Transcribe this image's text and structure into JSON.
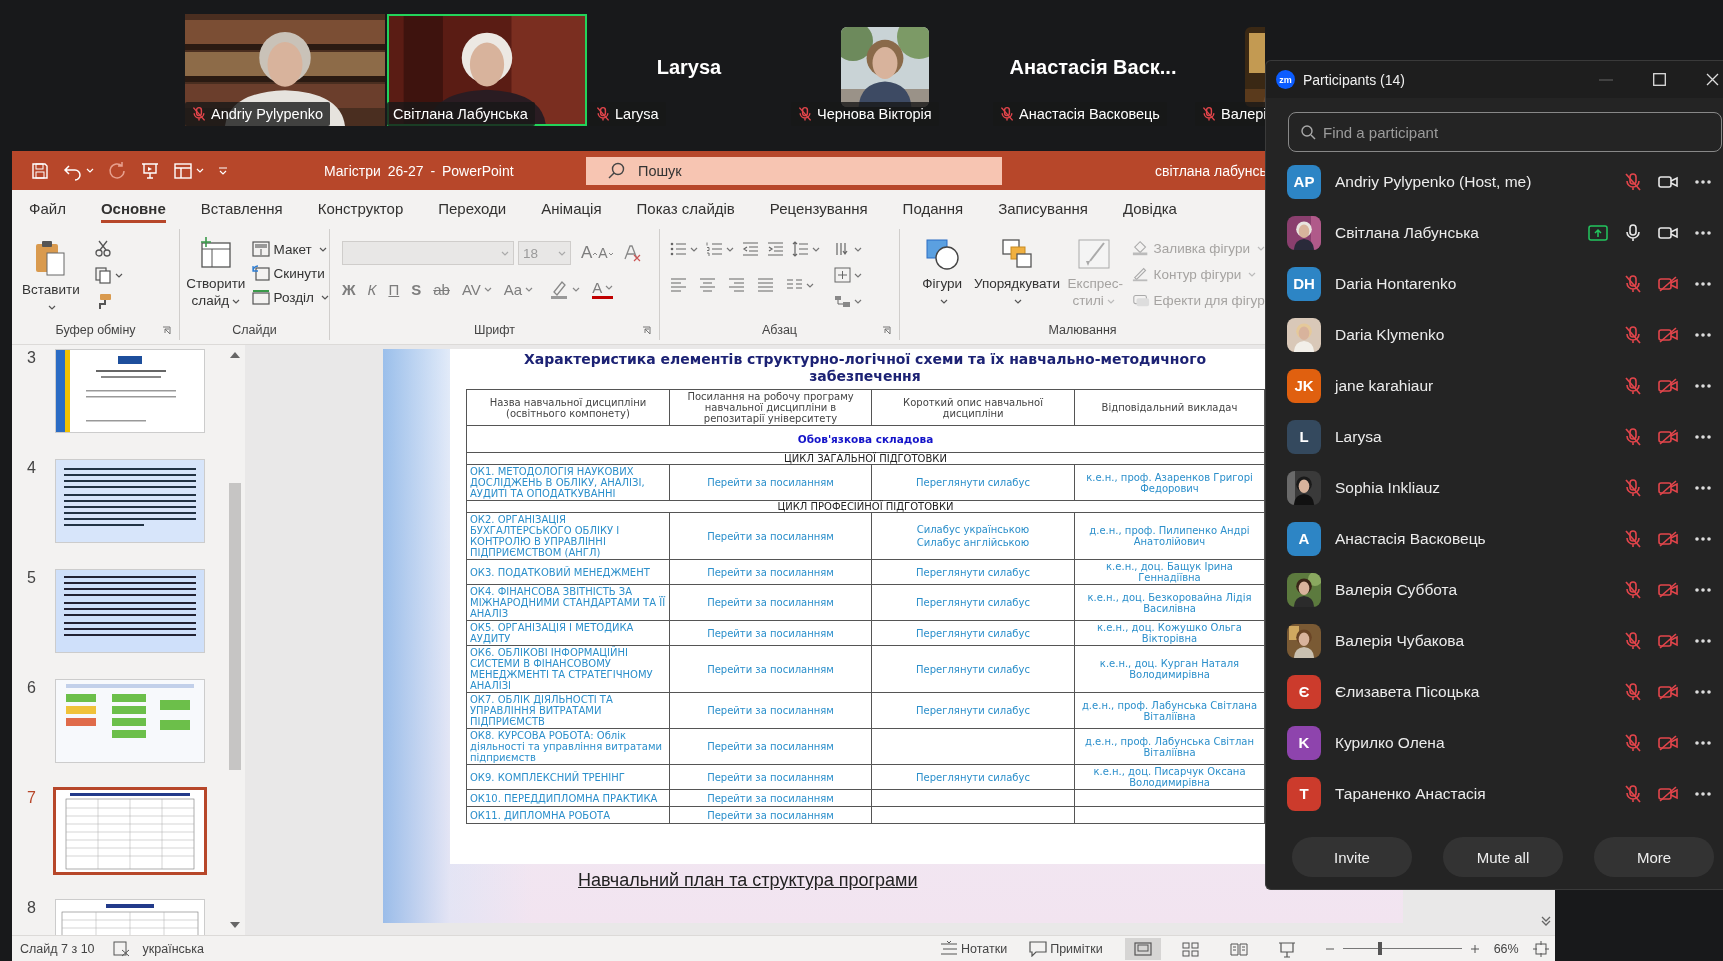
{
  "video_strip": {
    "tiles": [
      {
        "kind": "video",
        "label": "Andriy Pylypenko",
        "muted": true,
        "speaking": false
      },
      {
        "kind": "video",
        "label": "Світлана Лабунська",
        "muted": false,
        "speaking": true
      },
      {
        "kind": "name",
        "display": "Larysa",
        "label": "Larysa",
        "muted": true,
        "speaking": false
      },
      {
        "label": "Чернова Вікторія",
        "muted": true,
        "speaking": false
      },
      {
        "kind": "name",
        "display": "Анастасія Васк...",
        "label": "Анастасія Васковець",
        "muted": true,
        "speaking": false
      },
      {
        "label": "Валері",
        "muted": true,
        "speaking": false
      }
    ]
  },
  "powerpoint": {
    "title": "Магістри 26-27 - PowerPoint",
    "search_placeholder": "Пошук",
    "user": "світлана лабунсь",
    "tabs": [
      {
        "label": "Файл",
        "selected": false
      },
      {
        "label": "Основне",
        "selected": true
      },
      {
        "label": "Вставлення",
        "selected": false
      },
      {
        "label": "Конструктор",
        "selected": false
      },
      {
        "label": "Переходи",
        "selected": false
      },
      {
        "label": "Анімація",
        "selected": false
      },
      {
        "label": "Показ слайдів",
        "selected": false
      },
      {
        "label": "Рецензування",
        "selected": false
      },
      {
        "label": "Подання",
        "selected": false
      },
      {
        "label": "Записування",
        "selected": false
      },
      {
        "label": "Довідка",
        "selected": false
      }
    ],
    "ribbon": {
      "clipboard": {
        "label": "Буфер обміну",
        "paste": "Вставити"
      },
      "slides": {
        "label": "Слайди",
        "new_slide": "Створити слайд",
        "items": [
          "Макет",
          "Скинути",
          "Розділ"
        ]
      },
      "font": {
        "label": "Шрифт",
        "size": "18",
        "grow": "A",
        "shrink": "A",
        "formats": [
          "Ж",
          "К",
          "П",
          "S",
          "ab",
          "AV",
          "Aa"
        ],
        "font_color_button": "A"
      },
      "paragraph": {
        "label": "Абзац"
      },
      "drawing": {
        "label": "Малювання",
        "big": [
          {
            "label": "Фігури",
            "disabled": false
          },
          {
            "label": "Упорядкувати",
            "disabled": false
          },
          {
            "label": "Експрес-стилі",
            "disabled": true
          }
        ],
        "small": [
          {
            "label": "Заливка фігури",
            "disabled": true
          },
          {
            "label": "Контур фігури",
            "disabled": true
          },
          {
            "label": "Ефекти для фігур",
            "disabled": true
          }
        ]
      }
    },
    "thumbnails": [
      {
        "number": "3",
        "selected": false
      },
      {
        "number": "4",
        "selected": false
      },
      {
        "number": "5",
        "selected": false
      },
      {
        "number": "6",
        "selected": false
      },
      {
        "number": "7",
        "selected": true
      },
      {
        "number": "8",
        "selected": false
      }
    ],
    "slide": {
      "title": "Характеристика елементів структурно-логічної схеми та їх навчально-методичного забезпечення",
      "columns": [
        "Назва навчальної дисципліни (освітнього компонету)",
        "Посилання на робочу програму навчальної дисципліни в репозитарії університету",
        "Короткий опис навчальної дисципліни",
        "Відповідальний викладач"
      ],
      "rows": [
        {
          "kind": "section",
          "text": "Обов'язкова складова"
        },
        {
          "kind": "cycle",
          "text": "ЦИКЛ ЗАГАЛЬНОЇ ПІДГОТОВКИ"
        },
        {
          "kind": "course",
          "name": "ОК1. МЕТОДОЛОГІЯ НАУКОВИХ ДОСЛІДЖЕНЬ В ОБЛІКУ, АНАЛІЗІ, АУДИТІ ТА ОПОДАТКУВАННІ",
          "link": "Перейти за посиланням",
          "syllabus": [
            "Переглянути силабус"
          ],
          "teacher": "к.е.н., проф. Азаренков Григорі Федорович"
        },
        {
          "kind": "cycle",
          "text": "ЦИКЛ ПРОФЕСІЙНОЇ ПІДГОТОВКИ"
        },
        {
          "kind": "course",
          "name": "ОК2. ОРГАНІЗАЦІЯ БУХГАЛТЕРСЬКОГО ОБЛІКУ І КОНТРОЛЮ В УПРАВЛІННІ ПІДПРИЄМСТВОМ (АНГЛ)",
          "link": "Перейти за посиланням",
          "syllabus": [
            "Силабус українською",
            "Силабус англійською"
          ],
          "teacher": "д.е.н., проф. Пилипенко Андрі Анатолійович"
        },
        {
          "kind": "course",
          "name": "ОК3. ПОДАТКОВИЙ МЕНЕДЖМЕНТ",
          "link": "Перейти за посиланням",
          "syllabus": [
            "Переглянути силабус"
          ],
          "teacher": "к.е.н., доц. Бащук Ірина Геннадіївна"
        },
        {
          "kind": "course",
          "name": "ОК4. ФІНАНСОВА ЗВІТНІСТЬ ЗА МІЖНАРОДНИМИ СТАНДАРТАМИ ТА ЇЇ АНАЛІЗ",
          "link": "Перейти за посиланням",
          "syllabus": [
            "Переглянути силабус"
          ],
          "teacher": "к.е.н., доц. Безкоровайна Лідія Василівна"
        },
        {
          "kind": "course",
          "name": "ОК5. ОРГАНІЗАЦІЯ І МЕТОДИКА АУДИТУ",
          "link": "Перейти за посиланням",
          "syllabus": [
            "Переглянути силабус"
          ],
          "teacher": "к.е.н., доц. Кожушко Ольга Вікторівна"
        },
        {
          "kind": "course",
          "name": "ОК6. ОБЛІКОВІ ІНФОРМАЦІЙНІ СИСТЕМИ В ФІНАНСОВОМУ МЕНЕДЖМЕНТІ ТА СТРАТЕГІЧНОМУ АНАЛІЗІ",
          "link": "Перейти за посиланням",
          "syllabus": [
            "Переглянути силабус"
          ],
          "teacher": "к.е.н., доц. Курган Наталя Володимирівна"
        },
        {
          "kind": "course",
          "name": "ОК7. ОБЛІК ДІЯЛЬНОСТІ ТА УПРАВЛІННЯ ВИТРАТАМИ ПІДПРИЄМСТВ",
          "link": "Перейти за посиланням",
          "syllabus": [
            "Переглянути силабус"
          ],
          "teacher": "д.е.н., проф. Лабунська Світлана Віталіївна"
        },
        {
          "kind": "course",
          "name": "ОК8. КУРСОВА РОБОТА: Облік діяльності та управління витратами підприємств",
          "link": "Перейти за посиланням",
          "teacher": "д.е.н., проф. Лабунська Світлан Віталіївна"
        },
        {
          "kind": "course",
          "name": "ОК9. КОМПЛЕКСНИЙ ТРЕНІНГ",
          "link": "Перейти за посиланням",
          "syllabus": [
            "Переглянути силабус"
          ],
          "teacher": "к.е.н., доц. Писарчук Оксана Володимирівна"
        },
        {
          "kind": "course",
          "name": "ОК10. ПЕРЕДДИПЛОМНА ПРАКТИКА",
          "link": "Перейти за посиланням"
        },
        {
          "kind": "course",
          "name": "ОК11. ДИПЛОМНА РОБОТА",
          "link": "Перейти за посиланням"
        }
      ],
      "link": "Навчальний план та структура програми"
    },
    "status_bar": {
      "slide": "Слайд 7 з 10",
      "language": "українська",
      "notes": "Нотатки",
      "comments": "Примітки",
      "views": [
        {
          "kind": "normal",
          "selected": true
        },
        {
          "kind": "sorter",
          "selected": false
        },
        {
          "kind": "reading",
          "selected": false
        },
        {
          "kind": "slideshow",
          "selected": false
        }
      ],
      "zoom": {
        "level": 0.31
      },
      "zoom_reading": "66%"
    }
  },
  "participants": {
    "logo": "zm",
    "title": "Participants (14)",
    "search_placeholder": "Find a participant",
    "items": [
      {
        "name": "Andriy Pylypenko (Host, me)",
        "avatar": {
          "kind": "initials",
          "text": "AP",
          "color": "#2d85c5"
        },
        "sharing": false,
        "mic_muted": true,
        "video_off": false
      },
      {
        "name": "Світлана Лабунська",
        "sharing": true,
        "mic_muted": false,
        "video_off": false
      },
      {
        "name": "Daria Hontarenko",
        "avatar": {
          "kind": "initials",
          "text": "DH",
          "color": "#2d85c5"
        },
        "sharing": false,
        "mic_muted": true,
        "video_off": true
      },
      {
        "name": "Daria Klymenko",
        "sharing": false,
        "mic_muted": true,
        "video_off": true
      },
      {
        "name": "jane karahiaur",
        "avatar": {
          "kind": "initials",
          "text": "JK",
          "color": "#e0600f"
        },
        "sharing": false,
        "mic_muted": true,
        "video_off": true
      },
      {
        "name": "Larysa",
        "avatar": {
          "kind": "initials",
          "text": "L",
          "color": "#34495e"
        },
        "sharing": false,
        "mic_muted": true,
        "video_off": true
      },
      {
        "name": "Sophia Inkliauz",
        "sharing": false,
        "mic_muted": true,
        "video_off": true
      },
      {
        "name": "Анастасія Васковець",
        "avatar": {
          "kind": "initials",
          "text": "A",
          "color": "#2d85c5"
        },
        "sharing": false,
        "mic_muted": true,
        "video_off": true
      },
      {
        "name": "Валерія Суббота",
        "sharing": false,
        "mic_muted": true,
        "video_off": true
      },
      {
        "name": "Валерія Чубакова",
        "sharing": false,
        "mic_muted": true,
        "video_off": true
      },
      {
        "name": "Єлизавета Пісоцька",
        "avatar": {
          "kind": "initials",
          "text": "Є",
          "color": "#cc3b2c"
        },
        "sharing": false,
        "mic_muted": true,
        "video_off": true
      },
      {
        "name": "Курилко Олена",
        "avatar": {
          "kind": "initials",
          "text": "K",
          "color": "#8e44ad"
        },
        "sharing": false,
        "mic_muted": true,
        "video_off": true
      },
      {
        "name": "Тараненко Анастасія",
        "avatar": {
          "kind": "initials",
          "text": "T",
          "color": "#cc3b2c"
        },
        "sharing": false,
        "mic_muted": true,
        "video_off": true
      }
    ],
    "buttons": [
      "Invite",
      "Mute all",
      "More"
    ]
  }
}
